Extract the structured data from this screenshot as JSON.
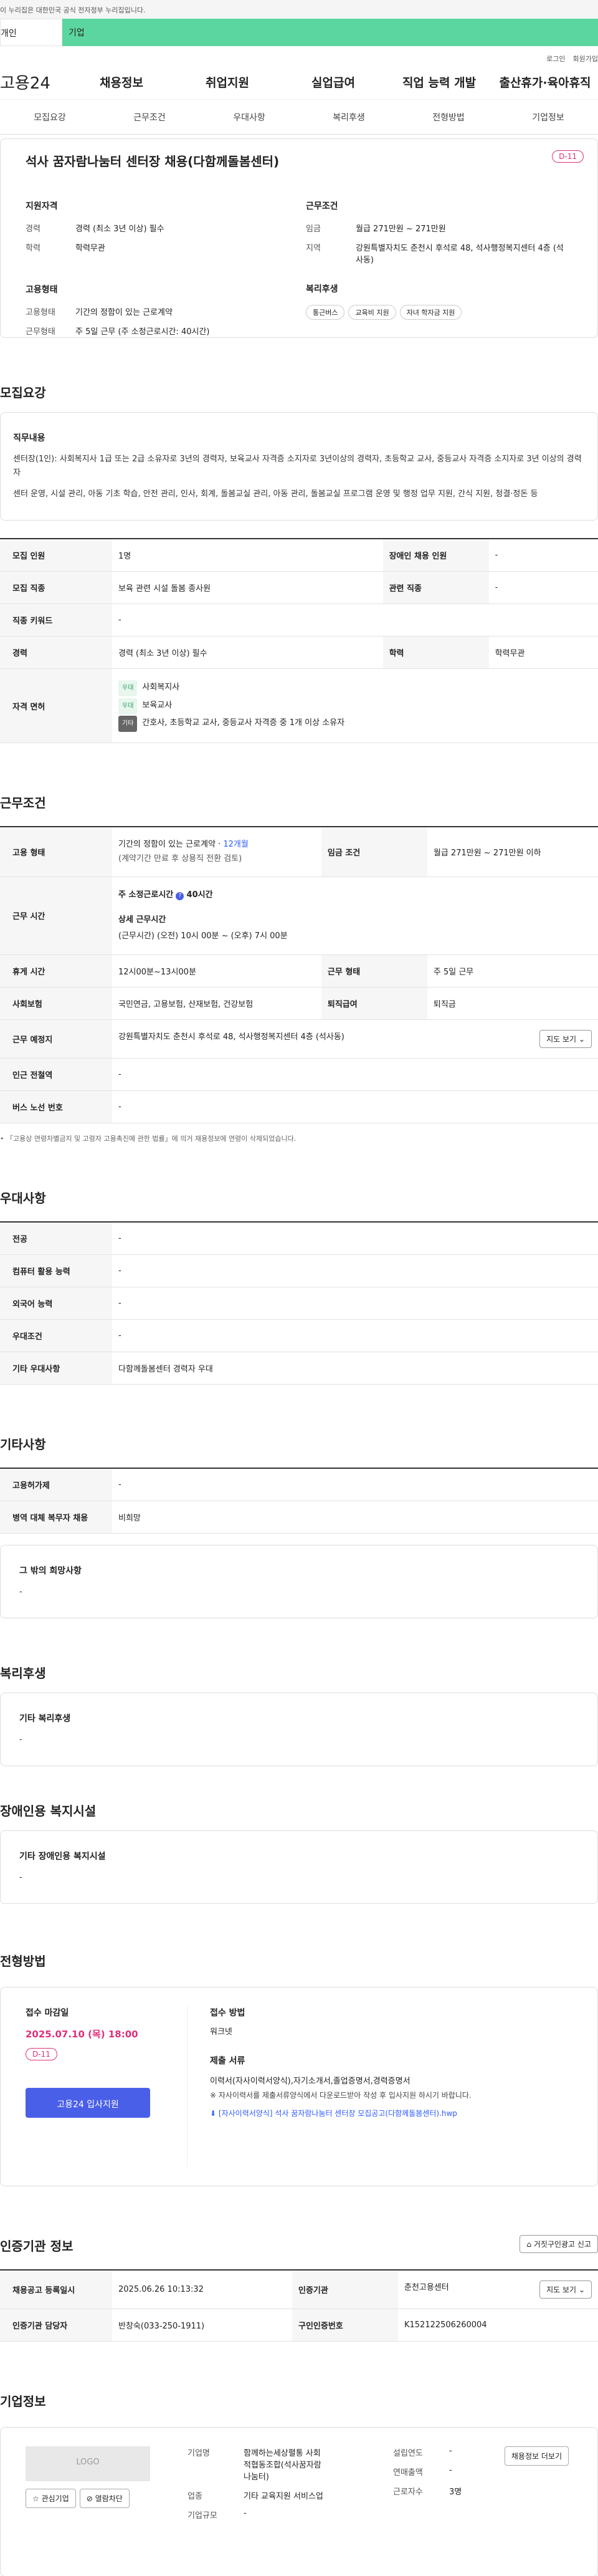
{
  "gov_bar": "이 누리집은 대한민국 공식 전자정부 누리집입니다.",
  "tabs": {
    "personal": "개인",
    "company": "기업"
  },
  "utility": {
    "login": "로그인",
    "signup": "회원가입"
  },
  "gnb": {
    "logo": "고용24",
    "items": [
      "채용정보",
      "취업지원",
      "실업급여",
      "직업 능력 개발",
      "출산휴가·육아휴직"
    ]
  },
  "subnav": [
    "모집요강",
    "근무조건",
    "우대사항",
    "복리후생",
    "전형방법",
    "기업정보"
  ],
  "summary": {
    "title": "석사 꿈자람나눔터 센터장 채용(다함께돌봄센터)",
    "dday": "D-11",
    "qual_head": "지원자격",
    "cond_head": "근무조건",
    "emp_head": "고용형태",
    "wel_head": "복리후생",
    "career_k": "경력",
    "career_v": "경력 (최소 3년 이상) 필수",
    "edu_k": "학력",
    "edu_v": "학력무관",
    "wage_k": "임금",
    "wage_v": "월급 271만원 ~ 271만원",
    "loc_k": "지역",
    "loc_v": "강원특별자치도 춘천시 후석로 48, 석사행정복지센터 4층 (석사동)",
    "type_k": "고용형태",
    "type_v": "기간의 정함이 있는 근로계약",
    "form_k": "근무형태",
    "form_v": "주 5일 근무 (주 소정근로시간: 40시간)",
    "chips": [
      "통근버스",
      "교육비 지원",
      "자녀 학자금 지원"
    ]
  },
  "recruit": {
    "title": "모집요강",
    "duty_head": "직무내용",
    "duty_1": "센터장(1인): 사회복지사 1급 또는 2급 소유자로 3년의 경력자, 보육교사 자격증 소지자로 3년이상의 경력자, 초등학교 교사, 중등교사 자격증 소지자로 3년 이상의 경력자",
    "duty_2": "센터 운영, 시설 관리, 아동 기초 학습, 안전 관리, 인사, 회계, 돌봄교실 관리, 아동 관리, 돌봄교실 프로그램 운영 및 행정 업무 지원, 간식 지원, 청결·정돈 등",
    "rows": {
      "count_k": "모집 인원",
      "count_v": "1명",
      "disabled_k": "장애인 채용 인원",
      "disabled_v": "-",
      "job_k": "모집 직종",
      "job_v": "보육 관련 시설 돌봄 종사원",
      "rel_k": "관련 직종",
      "rel_v": "-",
      "kw_k": "직종 키워드",
      "kw_v": "-",
      "career_k": "경력",
      "career_v": "경력 (최소 3년 이상) 필수",
      "edu_k": "학력",
      "edu_v": "학력무관",
      "lic_k": "자격 면허",
      "lic": [
        {
          "badge": "우대",
          "text": "사회복지사"
        },
        {
          "badge": "우대",
          "text": "보육교사"
        },
        {
          "badge": "기타",
          "text": "간호사, 초등학교 교사, 중등교사 자격증 중 1개 이상 소유자"
        }
      ]
    }
  },
  "work": {
    "title": "근무조건",
    "type_k": "고용 형태",
    "type_v": "기간의 정함이 있는 근로계약 · ",
    "type_period": "12개월",
    "type_sub": "(계약기간 만료 후 상용직 전환 검토)",
    "wage_k": "임금 조건",
    "wage_v": "월급 271만원 ~ 271만원 이하",
    "hours_k": "근무 시간",
    "hours_label": "주 소정근로시간",
    "hours_v": "40시간",
    "hours_detail_label": "상세 근무시간",
    "hours_detail": "(근무시간) (오전) 10시 00분 ~ (오후) 7시 00분",
    "rest_k": "휴게 시간",
    "rest_v": "12시00분~13시00분",
    "form_k": "근무 형태",
    "form_v": "주 5일 근무",
    "ins_k": "사회보험",
    "ins_v": "국민연금, 고용보험, 산재보험, 건강보험",
    "sev_k": "퇴직급여",
    "sev_v": "퇴직금",
    "place_k": "근무 예정지",
    "place_v": "강원특별자치도 춘천시 후석로 48, 석사행정복지센터 4층 (석사동)",
    "map_btn": "지도 보기",
    "subway_k": "인근 전철역",
    "subway_v": "-",
    "bus_k": "버스 노선 번호",
    "bus_v": "-",
    "note": "• 「고용상 연령차별금지 및 고령자 고용촉진에 관한 법률」에 의거 채용정보에 연령이 삭제되었습니다."
  },
  "pref": {
    "title": "우대사항",
    "major_k": "전공",
    "major_v": "-",
    "pc_k": "컴퓨터 활용 능력",
    "pc_v": "-",
    "lang_k": "외국어 능력",
    "lang_v": "-",
    "cond_k": "우대조건",
    "cond_v": "-",
    "etc_k": "기타 우대사항",
    "etc_v": "다함께돌봄센터 경력자 우대"
  },
  "etc": {
    "title": "기타사항",
    "emp_k": "고용허가제",
    "emp_v": "-",
    "mil_k": "병역 대체 복무자 채용",
    "mil_v": "비희망",
    "hope_head": "그 밖의 희망사항",
    "hope_v": "-"
  },
  "welfare": {
    "title": "복리후생",
    "head": "기타 복리후생",
    "v": "-"
  },
  "disabled": {
    "title": "장애인용 복지시설",
    "head": "기타 장애인용 복지시설",
    "v": "-"
  },
  "apply": {
    "title": "전형방법",
    "deadline_head": "접수 마감일",
    "deadline_v": "2025.07.10 (목) 18:00",
    "dday": "D-11",
    "btn": "고용24 입사지원",
    "method_head": "접수 방법",
    "method_v": "워크넷",
    "docs_head": "제출 서류",
    "docs_1": "이력서(자사이력서양식),자기소개서,졸업증명서,경력증명서",
    "docs_2": "※ 자사이력서를 제출서류양식에서 다운로드받아 작성 후 입사지원 하시기 바랍니다.",
    "docs_link": "[자사이력서양식] 석사 꿈자람나눔터 센터장 모집공고(다함께돌봄센터).hwp"
  },
  "agency": {
    "title": "인증기관 정보",
    "report_btn": "거짓구인광고 신고",
    "date_k": "채용공고 등록일시",
    "date_v": "2025.06.26 10:13:32",
    "org_k": "인증기관",
    "org_v": "춘천고용센터",
    "map_btn": "지도 보기",
    "mgr_k": "인증기관 담당자",
    "mgr_v": "반창숙(033-250-1911)",
    "no_k": "구인인증번호",
    "no_v": "K152122506260004"
  },
  "company": {
    "title": "기업정보",
    "logo": "LOGO",
    "fav_btn": "관심기업",
    "block_btn": "열람차단",
    "name_k": "기업명",
    "name_v": "함께하는세상펼통 사회적협동조합(석사꿈자람나눔터)",
    "ind_k": "업종",
    "ind_v": "기타 교육지원 서비스업",
    "size_k": "기업규모",
    "size_v": "-",
    "found_k": "설립연도",
    "found_v": "-",
    "sales_k": "연매출액",
    "sales_v": "-",
    "emp_k": "근로자수",
    "emp_v": "3명",
    "info_btn": "채용정보 더보기"
  }
}
